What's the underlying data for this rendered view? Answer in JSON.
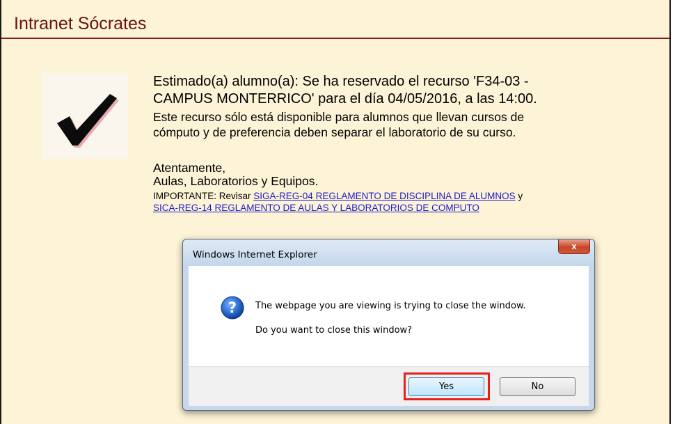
{
  "header": {
    "title": "Intranet Sócrates"
  },
  "message": {
    "main_line1": "Estimado(a) alumno(a): Se ha reservado el recurso 'F34-03 -",
    "main_line2": "CAMPUS MONTERRICO' para el día 04/05/2016, a las 14:00.",
    "sub_line1": "Este recurso sólo está disponible para alumnos que llevan cursos de",
    "sub_line2": "cómputo y de preferencia deben separar el laboratorio de su curso.",
    "signoff1": "Atentamente,",
    "signoff2": "Aulas, Laboratorios y Equipos.",
    "important_prefix": "IMPORTANTE: Revisar",
    "link1": "SIGA-REG-04 REGLAMENTO DE DISCIPLINA DE ALUMNOS",
    "important_and": "y",
    "link2": "SICA-REG-14 REGLAMENTO DE AULAS Y LABORATORIOS DE COMPUTO"
  },
  "icons": {
    "check": "checkmark-icon",
    "question": "question-icon",
    "close": "close-icon"
  },
  "dialog": {
    "title": "Windows Internet Explorer",
    "close_label": "x",
    "text1": "The webpage you are viewing is trying to close the window.",
    "text2": "Do you want to close this window?",
    "yes_label": "Yes",
    "no_label": "No"
  },
  "colors": {
    "page_bg": "#fdf3d6",
    "title": "#6a1212",
    "link": "#1c1ccc",
    "highlight": "#e8201c"
  }
}
